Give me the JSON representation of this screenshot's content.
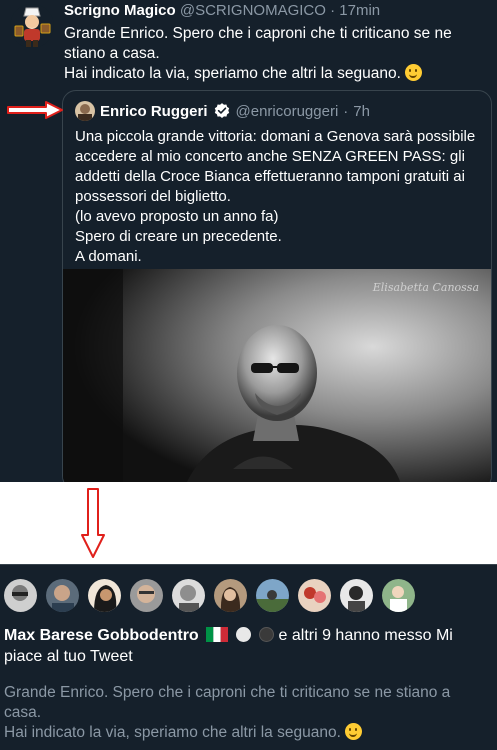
{
  "tweet": {
    "name": "Scrigno Magico",
    "handle": "@SCRIGNOMAGICO",
    "separator": "·",
    "time": "17min",
    "text_line1": "Grande Enrico. Spero che i caproni che ti criticano se ne stiano a casa.",
    "text_line2": "Hai indicato la via, speriamo che altri la seguano.",
    "avatar_icon": "magician-mascot-icon"
  },
  "quoted": {
    "name": "Enrico Ruggeri",
    "handle": "@enricoruggeri",
    "separator": "·",
    "time": "7h",
    "verified_icon": "verified-badge-icon",
    "lines": [
      "Una piccola grande vittoria: domani a Genova sarà possibile accedere al mio concerto anche SENZA GREEN PASS: gli addetti della Croce Bianca effettueranno tamponi gratuiti ai possessori del biglietto.",
      "(lo avevo proposto un anno fa)",
      "Spero di creare un precedente.",
      "A domani."
    ],
    "photo_signature": "Elisabetta Canossa"
  },
  "notification": {
    "liker_count_avatars": 10,
    "name": "Max Barese Gobbodentro",
    "rest": "e altri 9 hanno messo Mi piace al tuo Tweet",
    "quote_line1": "Grande Enrico. Spero che i caproni che ti criticano se ne stiano a casa.",
    "quote_line2": "Hai indicato la via, speriamo che altri la seguano."
  },
  "colors": {
    "background": "#15202b",
    "text": "#ffffff",
    "muted": "#8b98a5",
    "border": "#38444d",
    "verified": "#1d9bf0",
    "annotation_arrow": "#e0201b"
  }
}
